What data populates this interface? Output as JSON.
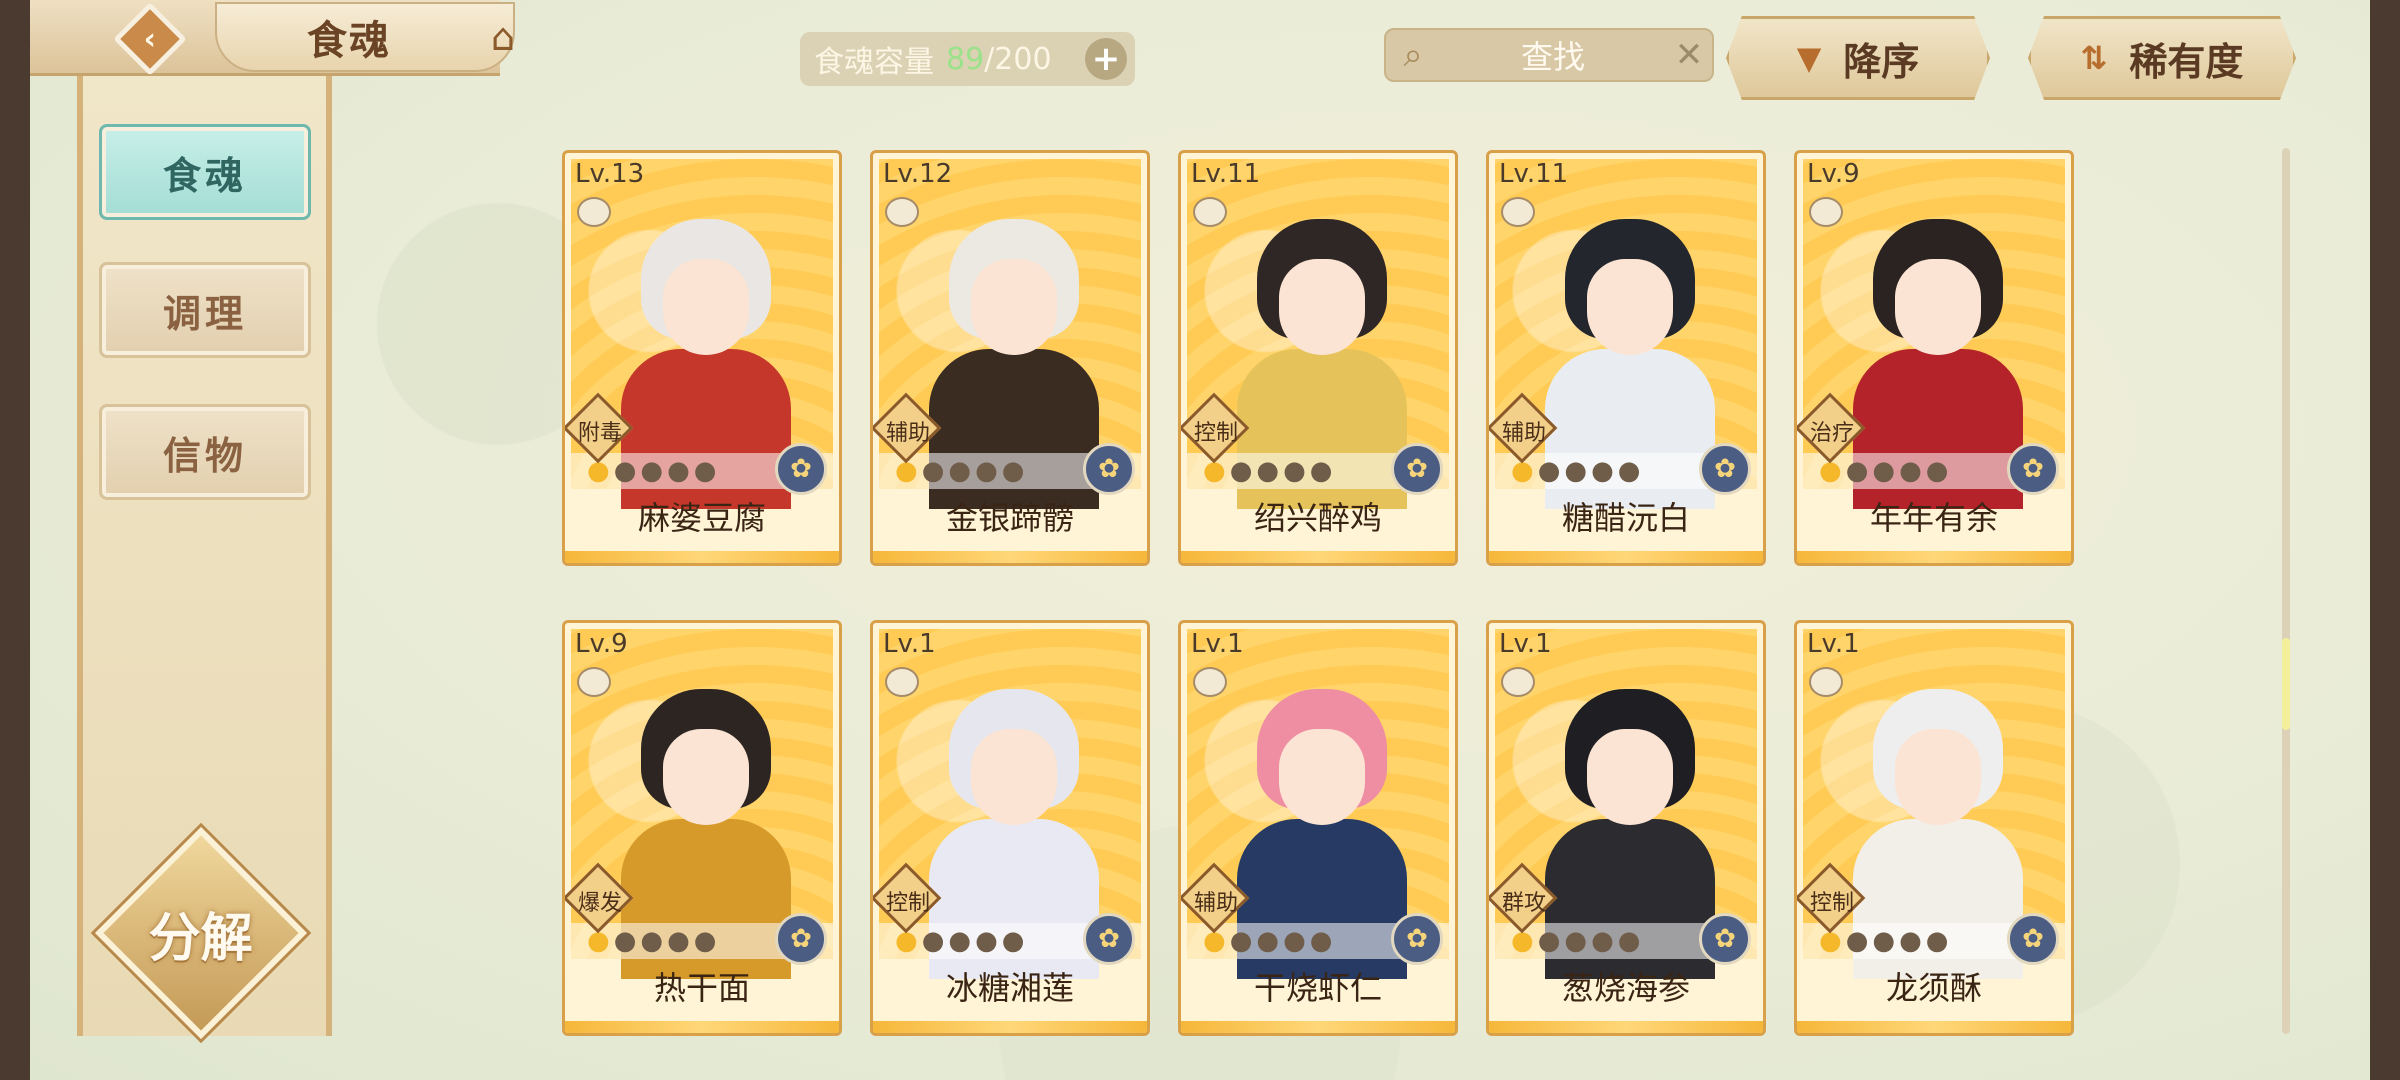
{
  "header": {
    "title": "食魂",
    "back_icon": "back-arrow-icon",
    "house_icon": "pavilion-icon"
  },
  "capacity": {
    "label": "食魂容量",
    "current": "89",
    "separator": "/",
    "max": "200",
    "plus": "+"
  },
  "search": {
    "placeholder": "查找",
    "clear": "✕"
  },
  "sort": {
    "order_label": "降序",
    "rarity_label": "稀有度"
  },
  "sidebar": {
    "items": [
      {
        "label": "食魂",
        "active": true
      },
      {
        "label": "调理",
        "active": false
      },
      {
        "label": "信物",
        "active": false
      }
    ],
    "decompose_label": "分解"
  },
  "cards": [
    {
      "level": "Lv.13",
      "role": "附毒",
      "name": "麻婆豆腐",
      "stars_lit": 1,
      "hair": "#e9e6e3",
      "body": "#c6372b"
    },
    {
      "level": "Lv.12",
      "role": "辅助",
      "name": "金银蹄髈",
      "stars_lit": 1,
      "hair": "#ece8e2",
      "body": "#3b2c22"
    },
    {
      "level": "Lv.11",
      "role": "控制",
      "name": "绍兴醉鸡",
      "stars_lit": 1,
      "hair": "#2f2726",
      "body": "#e5c35a"
    },
    {
      "level": "Lv.11",
      "role": "辅助",
      "name": "糖醋沅白",
      "stars_lit": 1,
      "hair": "#23262c",
      "body": "#e9edf1"
    },
    {
      "level": "Lv.9",
      "role": "治疗",
      "name": "年年有余",
      "stars_lit": 1,
      "hair": "#2b2321",
      "body": "#b5232a"
    },
    {
      "level": "Lv.9",
      "role": "爆发",
      "name": "热干面",
      "stars_lit": 1,
      "hair": "#2c2522",
      "body": "#d69a2a"
    },
    {
      "level": "Lv.1",
      "role": "控制",
      "name": "冰糖湘莲",
      "stars_lit": 1,
      "hair": "#e5e6ee",
      "body": "#e8e9f2"
    },
    {
      "level": "Lv.1",
      "role": "辅助",
      "name": "干烧虾仁",
      "stars_lit": 1,
      "hair": "#ef8ea3",
      "body": "#263a63"
    },
    {
      "level": "Lv.1",
      "role": "群攻",
      "name": "葱烧海参",
      "stars_lit": 1,
      "hair": "#1f1e22",
      "body": "#2c2b2f"
    },
    {
      "level": "Lv.1",
      "role": "控制",
      "name": "龙须酥",
      "stars_lit": 1,
      "hair": "#eeeeee",
      "body": "#f2efe8"
    }
  ]
}
